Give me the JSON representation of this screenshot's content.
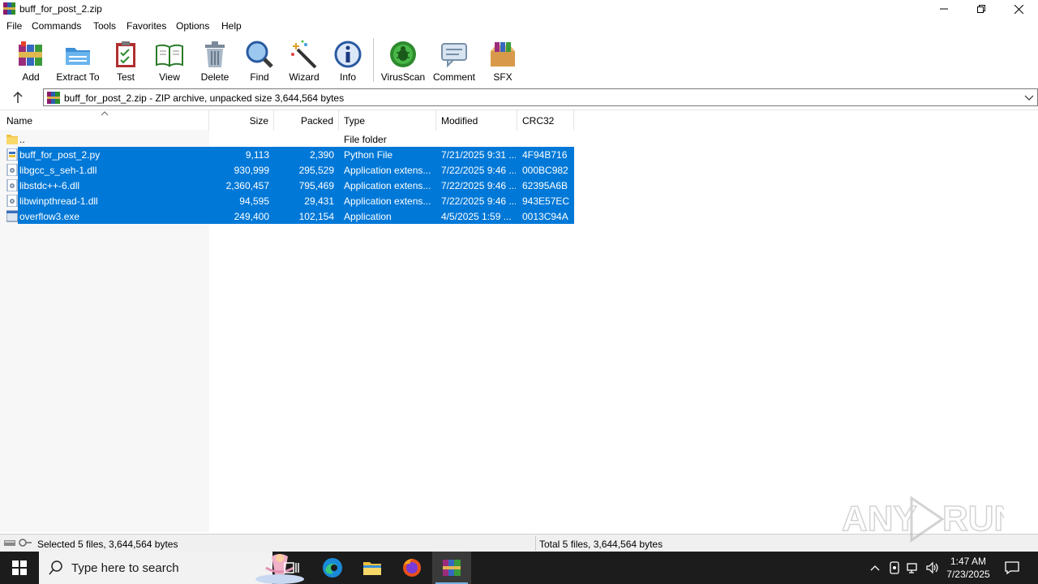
{
  "window": {
    "title": "buff_for_post_2.zip"
  },
  "menu": [
    "File",
    "Commands",
    "Tools",
    "Favorites",
    "Options",
    "Help"
  ],
  "toolbar": {
    "add": "Add",
    "extract_to": "Extract To",
    "test": "Test",
    "view": "View",
    "delete": "Delete",
    "find": "Find",
    "wizard": "Wizard",
    "info": "Info",
    "virusscan": "VirusScan",
    "comment": "Comment",
    "sfx": "SFX"
  },
  "address": {
    "text": "buff_for_post_2.zip - ZIP archive, unpacked size 3,644,564 bytes"
  },
  "columns": {
    "name": "Name",
    "size": "Size",
    "packed": "Packed",
    "type": "Type",
    "modified": "Modified",
    "crc": "CRC32"
  },
  "files": [
    {
      "name": "..",
      "size": "",
      "packed": "",
      "type": "File folder",
      "modified": "",
      "crc": "",
      "icon": "folder-icon",
      "selected": false
    },
    {
      "name": "buff_for_post_2.py",
      "size": "9,113",
      "packed": "2,390",
      "type": "Python File",
      "modified": "7/21/2025 9:31 ...",
      "crc": "4F94B716",
      "icon": "python-file-icon",
      "selected": true
    },
    {
      "name": "libgcc_s_seh-1.dll",
      "size": "930,999",
      "packed": "295,529",
      "type": "Application extens...",
      "modified": "7/22/2025 9:46 ...",
      "crc": "000BC982",
      "icon": "dll-file-icon",
      "selected": true
    },
    {
      "name": "libstdc++-6.dll",
      "size": "2,360,457",
      "packed": "795,469",
      "type": "Application extens...",
      "modified": "7/22/2025 9:46 ...",
      "crc": "62395A6B",
      "icon": "dll-file-icon",
      "selected": true
    },
    {
      "name": "libwinpthread-1.dll",
      "size": "94,595",
      "packed": "29,431",
      "type": "Application extens...",
      "modified": "7/22/2025 9:46 ...",
      "crc": "943E57EC",
      "icon": "dll-file-icon",
      "selected": true
    },
    {
      "name": "overflow3.exe",
      "size": "249,400",
      "packed": "102,154",
      "type": "Application",
      "modified": "4/5/2025 1:59 ...",
      "crc": "0013C94A",
      "icon": "exe-file-icon",
      "selected": true
    }
  ],
  "status": {
    "left": "Selected 5 files, 3,644,564 bytes",
    "right": "Total 5 files, 3,644,564 bytes"
  },
  "taskbar": {
    "search_placeholder": "Type here to search",
    "time": "1:47 AM",
    "date": "7/23/2025"
  },
  "colors": {
    "selection": "#0078d7",
    "taskbar": "#1c1c1c"
  }
}
